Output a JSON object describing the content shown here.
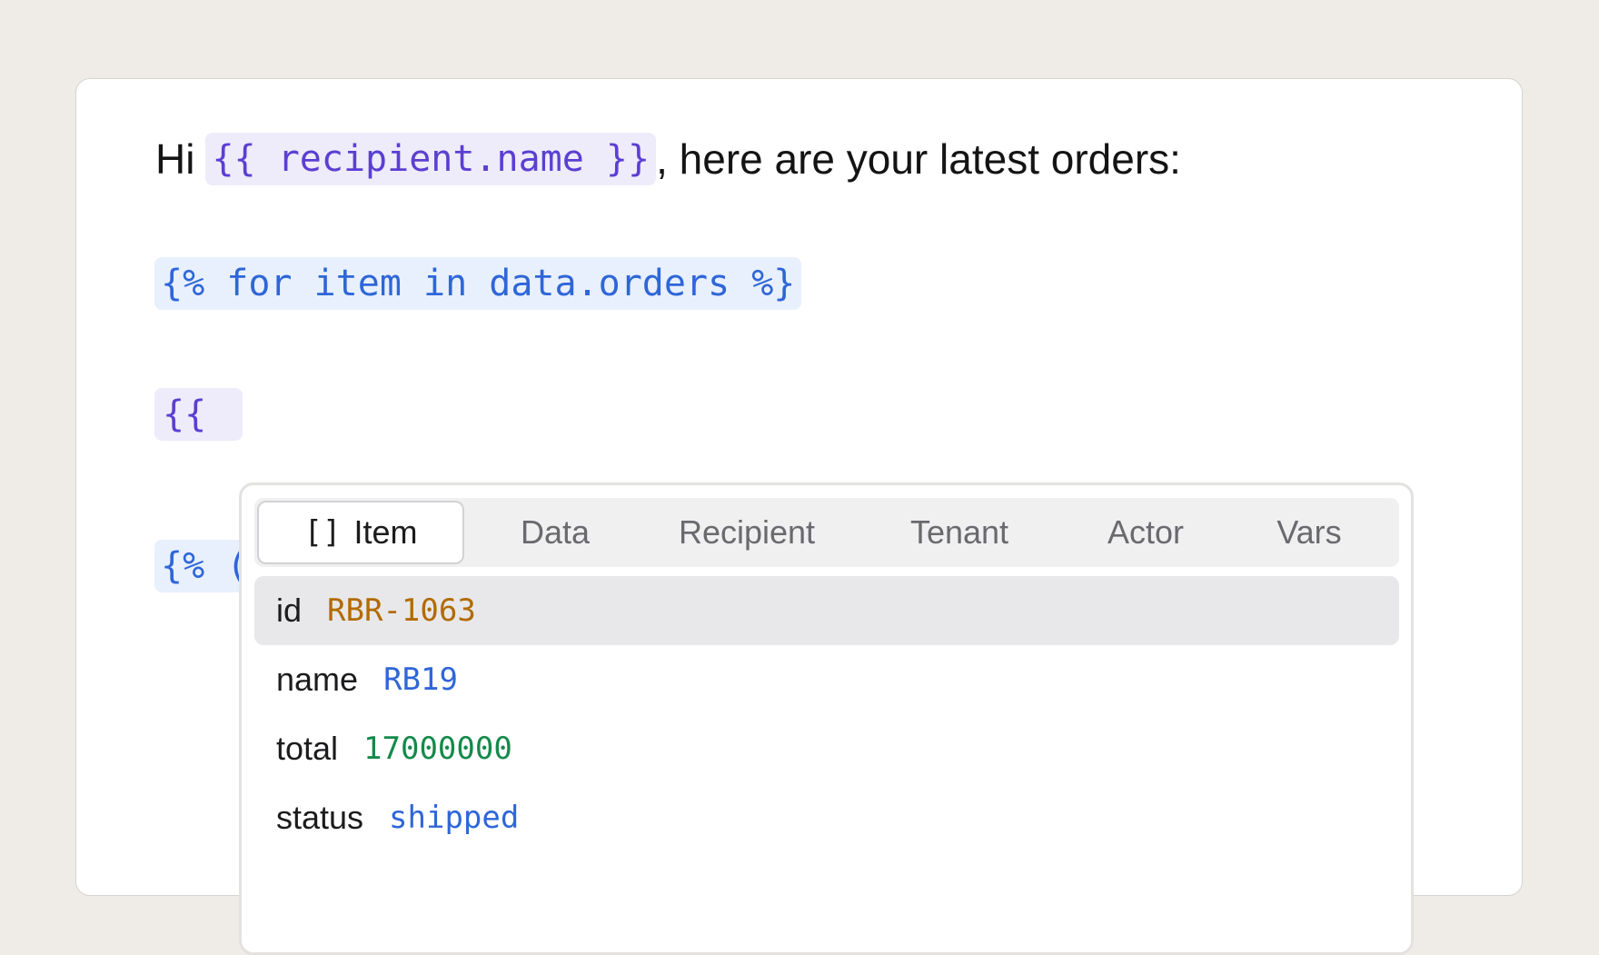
{
  "editor": {
    "greeting_prefix": "Hi",
    "recipient_variable": "{{ recipient.name }}",
    "greeting_suffix": ", here are your latest orders:",
    "for_tag": "{% for item in data.orders %}",
    "open_braces": "{{",
    "partial_tag": "{% ("
  },
  "autocomplete": {
    "tabs": [
      {
        "label": "Item",
        "icon": "[]",
        "active": true
      },
      {
        "label": "Data"
      },
      {
        "label": "Recipient"
      },
      {
        "label": "Tenant"
      },
      {
        "label": "Actor"
      },
      {
        "label": "Vars"
      }
    ],
    "rows": [
      {
        "key": "id",
        "value": "RBR-1063",
        "value_color": "#b26b00",
        "highlighted": true
      },
      {
        "key": "name",
        "value": "RB19",
        "value_color": "#2f66d8"
      },
      {
        "key": "total",
        "value": "17000000",
        "value_color": "#138a4a"
      },
      {
        "key": "status",
        "value": "shipped",
        "value_color": "#2f66d8"
      }
    ]
  },
  "colors": {
    "page_background": "#efece7",
    "variable_chip": "#eeebfb",
    "variable_text": "#5b3fd1",
    "tag_chip": "#e8f0fd",
    "tag_text": "#2f66d8"
  }
}
